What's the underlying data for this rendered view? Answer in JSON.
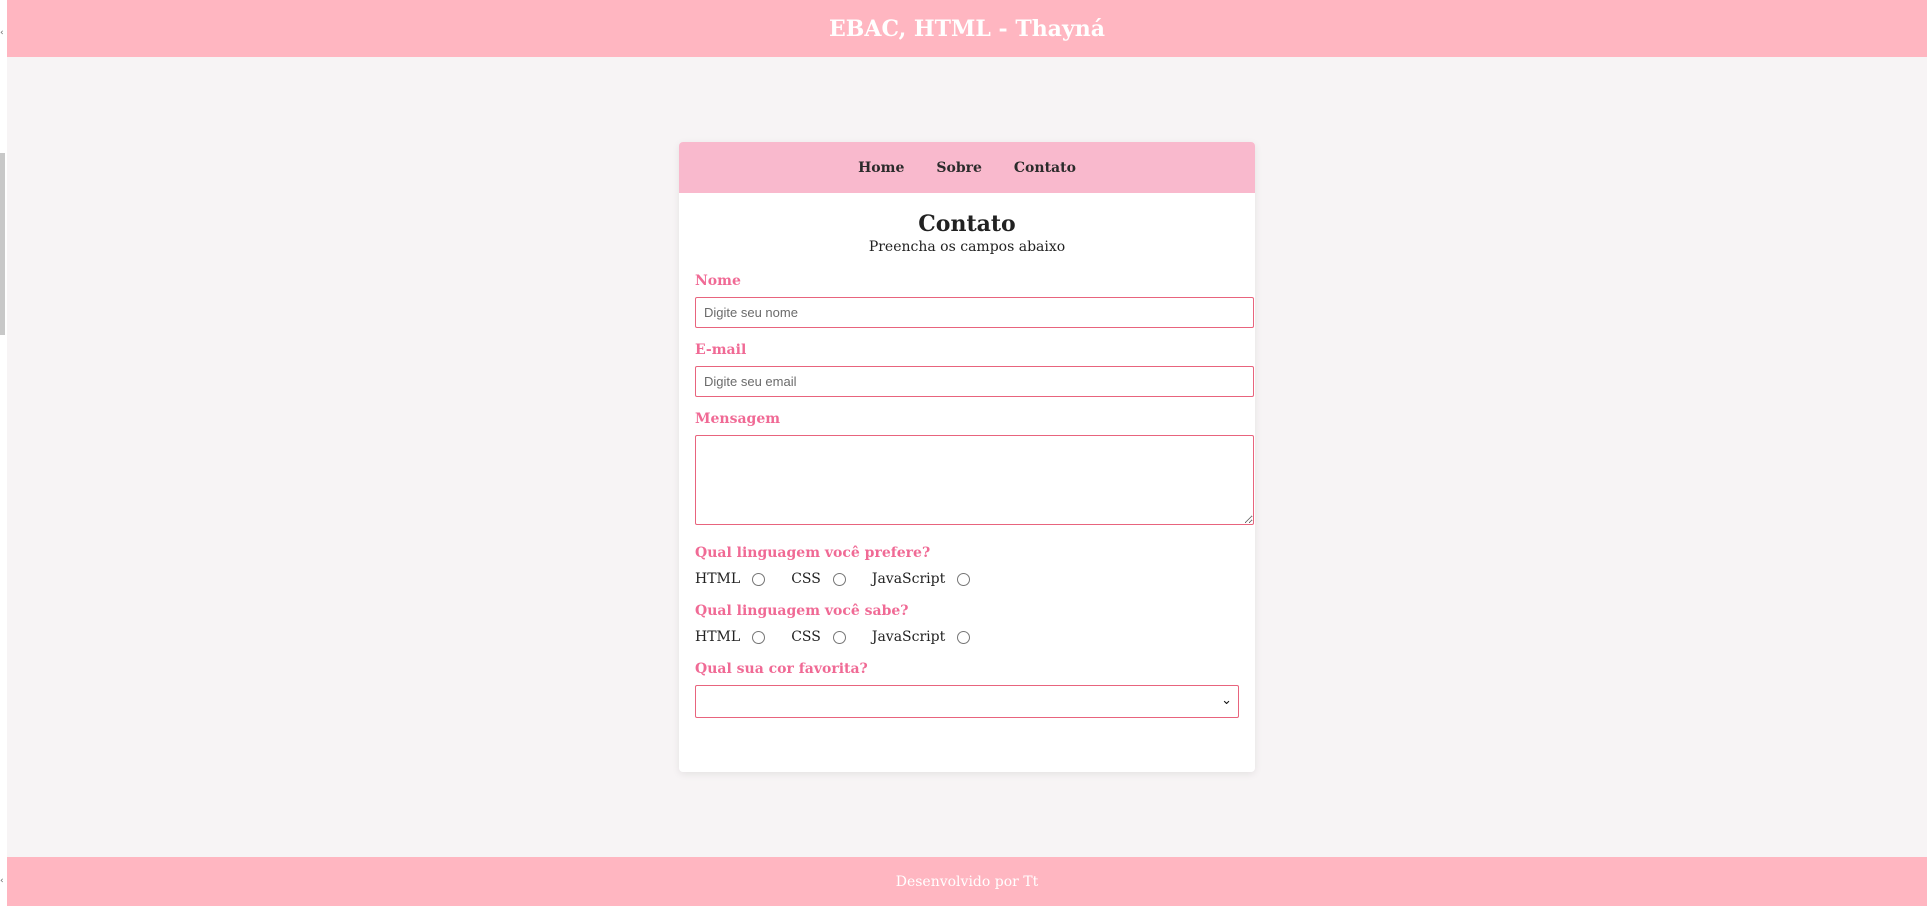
{
  "header": {
    "title": "EBAC, HTML - Thayná"
  },
  "nav": {
    "items": [
      {
        "label": "Home"
      },
      {
        "label": "Sobre"
      },
      {
        "label": "Contato"
      }
    ]
  },
  "contact": {
    "title": "Contato",
    "subtitle": "Preencha os campos abaixo",
    "name_label": "Nome",
    "name_placeholder": "Digite seu nome",
    "name_value": "",
    "email_label": "E-mail",
    "email_placeholder": "Digite seu email",
    "email_value": "",
    "message_label": "Mensagem",
    "message_value": "",
    "prefer_question": "Qual linguagem você prefere?",
    "prefer_options": [
      "HTML",
      "CSS",
      "JavaScript"
    ],
    "prefer_selected": null,
    "know_question": "Qual linguagem você sabe?",
    "know_options": [
      "HTML",
      "CSS",
      "JavaScript"
    ],
    "know_selected": null,
    "color_question": "Qual sua cor favorita?",
    "color_selected": ""
  },
  "footer": {
    "text": "Desenvolvido por Tt"
  },
  "colors": {
    "bar_pink": "#ffb6c1",
    "nav_pink": "#f9b9cd",
    "label_pink": "#f06a95",
    "input_border": "#e8647d",
    "page_bg": "#f7f4f5"
  },
  "icons": {
    "select_arrow": "chevron-down-icon"
  }
}
